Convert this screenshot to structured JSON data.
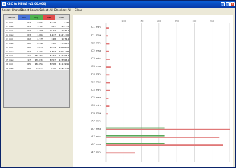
{
  "window": {
    "title": "CLC to MEGA (v1.00.000)",
    "buttons": {
      "minimize": "_",
      "maximize": "□",
      "close": "×"
    }
  },
  "menu": [
    "Select Channels",
    "Select Columns",
    "Select All",
    "Deselect All",
    "Clear"
  ],
  "table": {
    "headers": [
      "Name",
      "Min",
      "Avg",
      "Max",
      "Last"
    ],
    "header_colors": [
      "#dcdcdc",
      "#4a74d8",
      "#4fb34f",
      "#e04b4b",
      "#dcdcdc"
    ],
    "rows": [
      [
        "C1 min",
        "0.1",
        "4.085",
        "15.56",
        "7.746"
      ],
      [
        "C1 max",
        "0.1",
        "1.763",
        "26.7",
        "24.778"
      ],
      [
        "C2 min",
        "0.2",
        "4.365",
        "18.54",
        "1046.4"
      ],
      [
        "C2 max",
        "0.3",
        "3.062",
        "2.947",
        "1527.306"
      ],
      [
        "C3 min",
        "0.2",
        "2.775",
        "14.8",
        "1074.4"
      ],
      [
        "C3 max",
        "0.2",
        "8.396",
        "35.2",
        "27408.2"
      ],
      [
        "C4 min",
        "0.2",
        "4.870",
        "10.44",
        "10686.26"
      ],
      [
        "C4 max",
        "0.2",
        "5.397",
        "2.367",
        "1901.488"
      ],
      [
        "C5 min",
        "1.1",
        "140.452",
        "347.2",
        "142408.3"
      ],
      [
        "C5 max",
        "1.7",
        "176.034",
        "305.7",
        "123568.9"
      ],
      [
        "C6 min",
        "6.5",
        "150.052",
        "305.8",
        "41139.91"
      ],
      [
        "C6 max",
        "0.0",
        "74.673",
        "67.2",
        "41997.51"
      ]
    ]
  },
  "chart_data": {
    "type": "bar",
    "categories": [
      "C1 min",
      "C1 max",
      "C2 min",
      "C2 max",
      "C3 min",
      "C3 max",
      "C4 min",
      "C4 max",
      "C5 min",
      "C5 max",
      "C6 min",
      "C6 max",
      "A7 min",
      "A7 max",
      "A7 min",
      "A7 max",
      "A7 min"
    ],
    "series": [
      {
        "color": "#5aa85a",
        "values": [
          0,
          0,
          0,
          0,
          0,
          0,
          0,
          0,
          0,
          0,
          0,
          0,
          0,
          170,
          170,
          170,
          0
        ]
      },
      {
        "color": "#e07878",
        "values": [
          8,
          6,
          9,
          8,
          10,
          14,
          9,
          11,
          12,
          7,
          9,
          5,
          0,
          360,
          330,
          340,
          85
        ]
      }
    ],
    "xlim": [
      0,
      360
    ],
    "x_tick_labels": [
      "",
      "100",
      "150",
      "200",
      "250",
      "300",
      "350",
      ""
    ],
    "grid": true
  }
}
